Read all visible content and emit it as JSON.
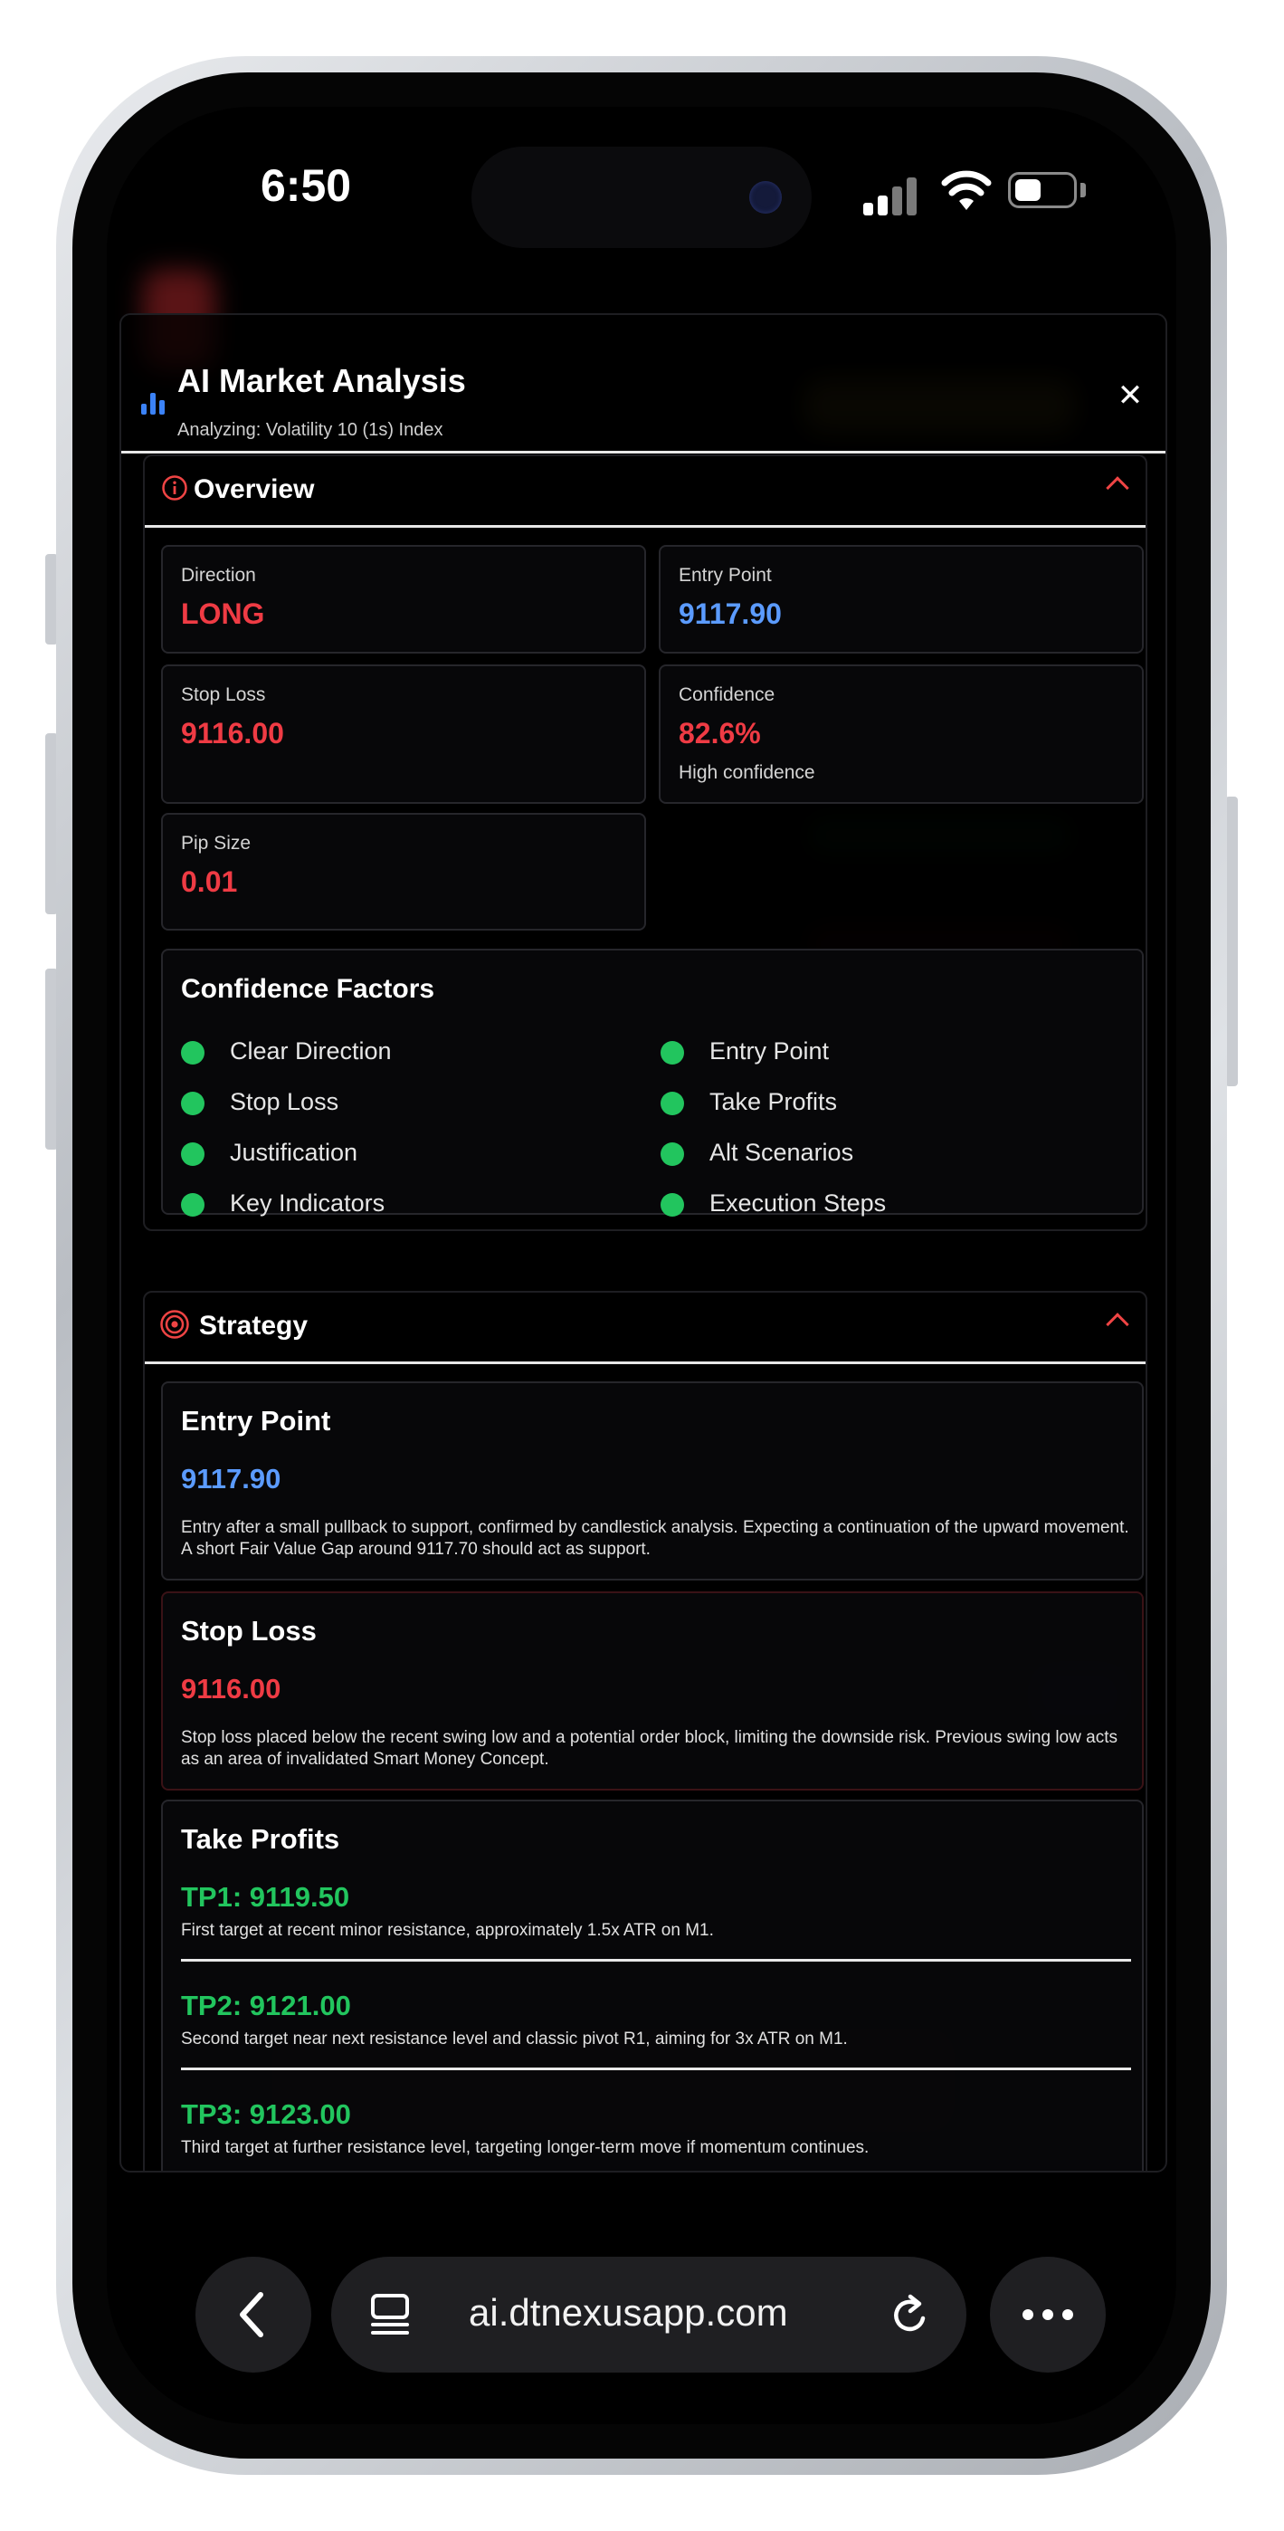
{
  "status_bar": {
    "time": "6:50"
  },
  "modal": {
    "title": "AI Market Analysis",
    "subtitle": "Analyzing: Volatility 10 (1s) Index"
  },
  "overview": {
    "title": "Overview",
    "direction": {
      "label": "Direction",
      "value": "LONG"
    },
    "entry_point": {
      "label": "Entry Point",
      "value": "9117.90"
    },
    "stop_loss": {
      "label": "Stop Loss",
      "value": "9116.00"
    },
    "confidence": {
      "label": "Confidence",
      "value": "82.6%",
      "note": "High confidence"
    },
    "pip_size": {
      "label": "Pip Size",
      "value": "0.01"
    },
    "confidence_factors": {
      "title": "Confidence Factors",
      "items": [
        "Clear Direction",
        "Entry Point",
        "Stop Loss",
        "Take Profits",
        "Justification",
        "Alt Scenarios",
        "Key Indicators",
        "Execution Steps"
      ]
    }
  },
  "strategy": {
    "title": "Strategy",
    "entry": {
      "title": "Entry Point",
      "value": "9117.90",
      "description": "Entry after a small pullback to support, confirmed by candlestick analysis. Expecting a continuation of the upward movement. A short Fair Value Gap around 9117.70 should act as support."
    },
    "stop": {
      "title": "Stop Loss",
      "value": "9116.00",
      "description": "Stop loss placed below the recent swing low and a potential order block, limiting the downside risk. Previous swing low acts as an area of invalidated Smart Money Concept."
    },
    "take_profits": {
      "title": "Take Profits",
      "items": [
        {
          "label": "TP1: 9119.50",
          "description": "First target at recent minor resistance, approximately 1.5x ATR on M1."
        },
        {
          "label": "TP2: 9121.00",
          "description": "Second target near next resistance level and classic pivot R1, aiming for 3x ATR on M1."
        },
        {
          "label": "TP3: 9123.00",
          "description": "Third target at further resistance level, targeting longer-term move if momentum continues."
        }
      ]
    }
  },
  "browser": {
    "url": "ai.dtnexusapp.com"
  },
  "colors": {
    "red": "#ef3b44",
    "blue": "#5b9bff",
    "green": "#22c55e",
    "background": "#000000"
  }
}
